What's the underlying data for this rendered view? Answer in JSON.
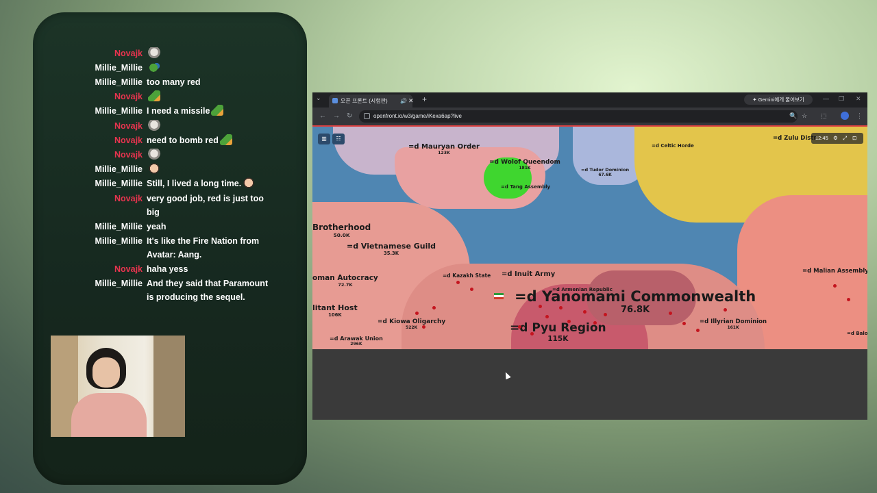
{
  "chat": {
    "messages": [
      {
        "user": "Novajk",
        "text": "",
        "emote": "cat-emote"
      },
      {
        "user": "Millie_Millie",
        "text": "",
        "emote": "frog-emote"
      },
      {
        "user": "Millie_Millie",
        "text": "too many red",
        "emote": ""
      },
      {
        "user": "Novajk",
        "text": "",
        "emote": "frog-missile-emote"
      },
      {
        "user": "Millie_Millie",
        "text": "I need a missile",
        "emote": "frog-missile-emote"
      },
      {
        "user": "Novajk",
        "text": "",
        "emote": "cat-emote"
      },
      {
        "user": "Novajk",
        "text": "need to bomb red",
        "emote": "frog-missile-emote"
      },
      {
        "user": "Novajk",
        "text": "",
        "emote": "cat-emote"
      },
      {
        "user": "Millie_Millie",
        "text": "",
        "emote": "face-emote"
      },
      {
        "user": "Millie_Millie",
        "text": "Still, I lived a long time.",
        "emote": "dog-emote"
      },
      {
        "user": "Novajk",
        "text": "very good job, red is just too big",
        "emote": ""
      },
      {
        "user": "Millie_Millie",
        "text": "yeah",
        "emote": ""
      },
      {
        "user": "Millie_Millie",
        "text": "It's like the Fire Nation from Avatar: Aang.",
        "emote": ""
      },
      {
        "user": "Novajk",
        "text": "haha yess",
        "emote": ""
      },
      {
        "user": "Millie_Millie",
        "text": "And they said that Paramount is producing the sequel.",
        "emote": ""
      }
    ]
  },
  "browser": {
    "tab_title": "오픈 프론트 (시험판)",
    "gemini_label": "Gemini에게 물어보기",
    "url": "openfront.io/w3/game/iKexa6ap?live"
  },
  "game": {
    "clock": "12:45",
    "labels": [
      {
        "name": "=d Mauryan Order",
        "pop": "123K"
      },
      {
        "name": "=d Wolof Queendom",
        "pop": "181K"
      },
      {
        "name": "=d Tang Assembly",
        "pop": ""
      },
      {
        "name": "=d Tudor Dominion",
        "pop": "67.6K"
      },
      {
        "name": "=d Celtic Horde",
        "pop": ""
      },
      {
        "name": "=d Zulu Distr",
        "pop": ""
      },
      {
        "name": "Brotherhood",
        "pop": "50.0K"
      },
      {
        "name": "=d Vietnamese Guild",
        "pop": "35.3K"
      },
      {
        "name": "=d Inuit Army",
        "pop": ""
      },
      {
        "name": "=d Kazakh State",
        "pop": ""
      },
      {
        "name": "oman Autocracy",
        "pop": "72.7K"
      },
      {
        "name": "=d Armenian Republic",
        "pop": ""
      },
      {
        "name": "=d Yanomami Commonwealth",
        "pop": "76.8K"
      },
      {
        "name": "=d Malian Assembly",
        "pop": ""
      },
      {
        "name": "litant Host",
        "pop": "106K"
      },
      {
        "name": "=d Kiowa Oligarchy",
        "pop": "522K"
      },
      {
        "name": "=d Pyu Region",
        "pop": "115K"
      },
      {
        "name": "=d Illyrian Dominion",
        "pop": "161K"
      },
      {
        "name": "=d Arawak Union",
        "pop": "296K"
      },
      {
        "name": "=d Baloc",
        "pop": ""
      }
    ]
  }
}
